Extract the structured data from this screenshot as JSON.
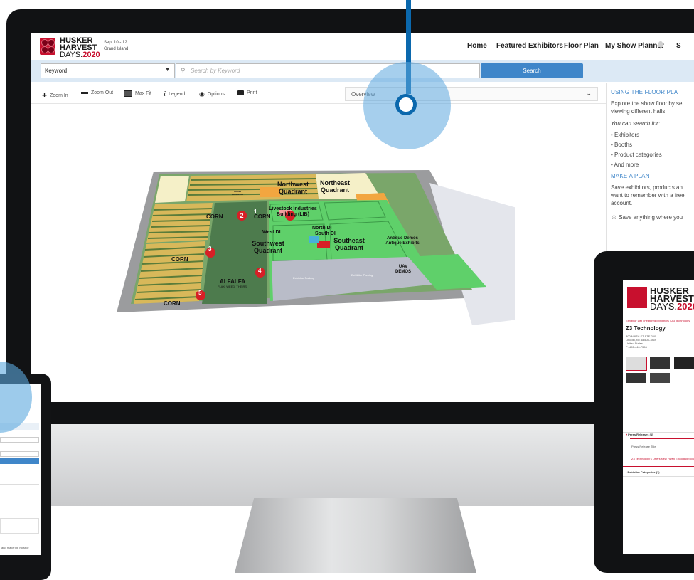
{
  "app": {
    "logo_line1": "HUSKER",
    "logo_line2": "HARVEST",
    "logo_line3_days": "DAYS.",
    "logo_line3_year": "2020",
    "event_dates": "Sep. 10 - 12",
    "event_location": "Grand Island"
  },
  "nav": {
    "home": "Home",
    "featured": "Featured Exhibitors",
    "floor_plan": "Floor Plan",
    "show_planner": "My Show Planner",
    "overflow": "S"
  },
  "search": {
    "scope_value": "Keyword",
    "placeholder": "Search by Keyword",
    "button_label": "Search"
  },
  "toolbar": {
    "zoom_in": "Zoom In",
    "zoom_out": "Zoom Out",
    "max_fit": "Max Fit",
    "legend": "Legend",
    "options": "Options",
    "print": "Print",
    "view_select": "Overview"
  },
  "side_panel": {
    "heading1": "USING THE FLOOR PLA",
    "text1_line1": "Explore the show floor by se",
    "text1_line2": "viewing different halls.",
    "search_intro": "You can search for:",
    "bullets": [
      "Exhibitors",
      "Booths",
      "Product categories",
      "And more"
    ],
    "heading2": "MAKE A PLAN",
    "text2_line1": "Save exhibitors, products an",
    "text2_line2": "want to remember with a free",
    "text2_line3": "account.",
    "save_line": "Save anything where you"
  },
  "map": {
    "zones": [
      {
        "num": "2",
        "label": "CORN"
      },
      {
        "num": "1",
        "label": "CORN"
      },
      {
        "num": "3",
        "label": "CORN"
      },
      {
        "num": "4",
        "label": "ALFALFA",
        "sub": "FLAX, WEED, THEIRS"
      },
      {
        "num": "5",
        "label": "CORN"
      }
    ],
    "quadrants": {
      "nw": "Northwest Quadrant",
      "ne": "Northeast Quadrant",
      "sw": "Southwest Quadrant",
      "se": "Southeast Quadrant"
    },
    "buildings": {
      "livestock": "Livestock Industries Building (LIB)",
      "west_di": "West DI",
      "north_di": "North DI",
      "south_di": "South DI",
      "antique": "Antique Demos Antique Exhibits",
      "uav": "UAV DEMOS",
      "grain": "GRAIN HANDLING",
      "exhibitor_parking1": "Exhibitor Parking",
      "exhibitor_parking2": "Exhibitor Parking"
    }
  },
  "tablet_right": {
    "company": "Z3 Technology",
    "breadcrumb": "Exhibitor List  /  Featured Exhibitors  /  Z3 Technology",
    "address": [
      "300 N 8TH ST STE 200",
      "Lincoln, NE 68508-1869",
      "United States",
      "P: 402-440-7566"
    ],
    "press_heading": "Press Releases (1)",
    "press_title_label": "Press Release Title",
    "press_item": "Z3 Technology's Offers New HDMI Encoding Solu",
    "categories_heading": "Exhibitor Categories (1)"
  },
  "tablet_left": {
    "footer_text": "and make the most of"
  },
  "colors": {
    "brand_red": "#c8102e",
    "accent_blue": "#3f86c9",
    "pin_blue": "#0b68ad",
    "field_green": "#5fd06a",
    "corn_stripe": "#d8b85a"
  }
}
